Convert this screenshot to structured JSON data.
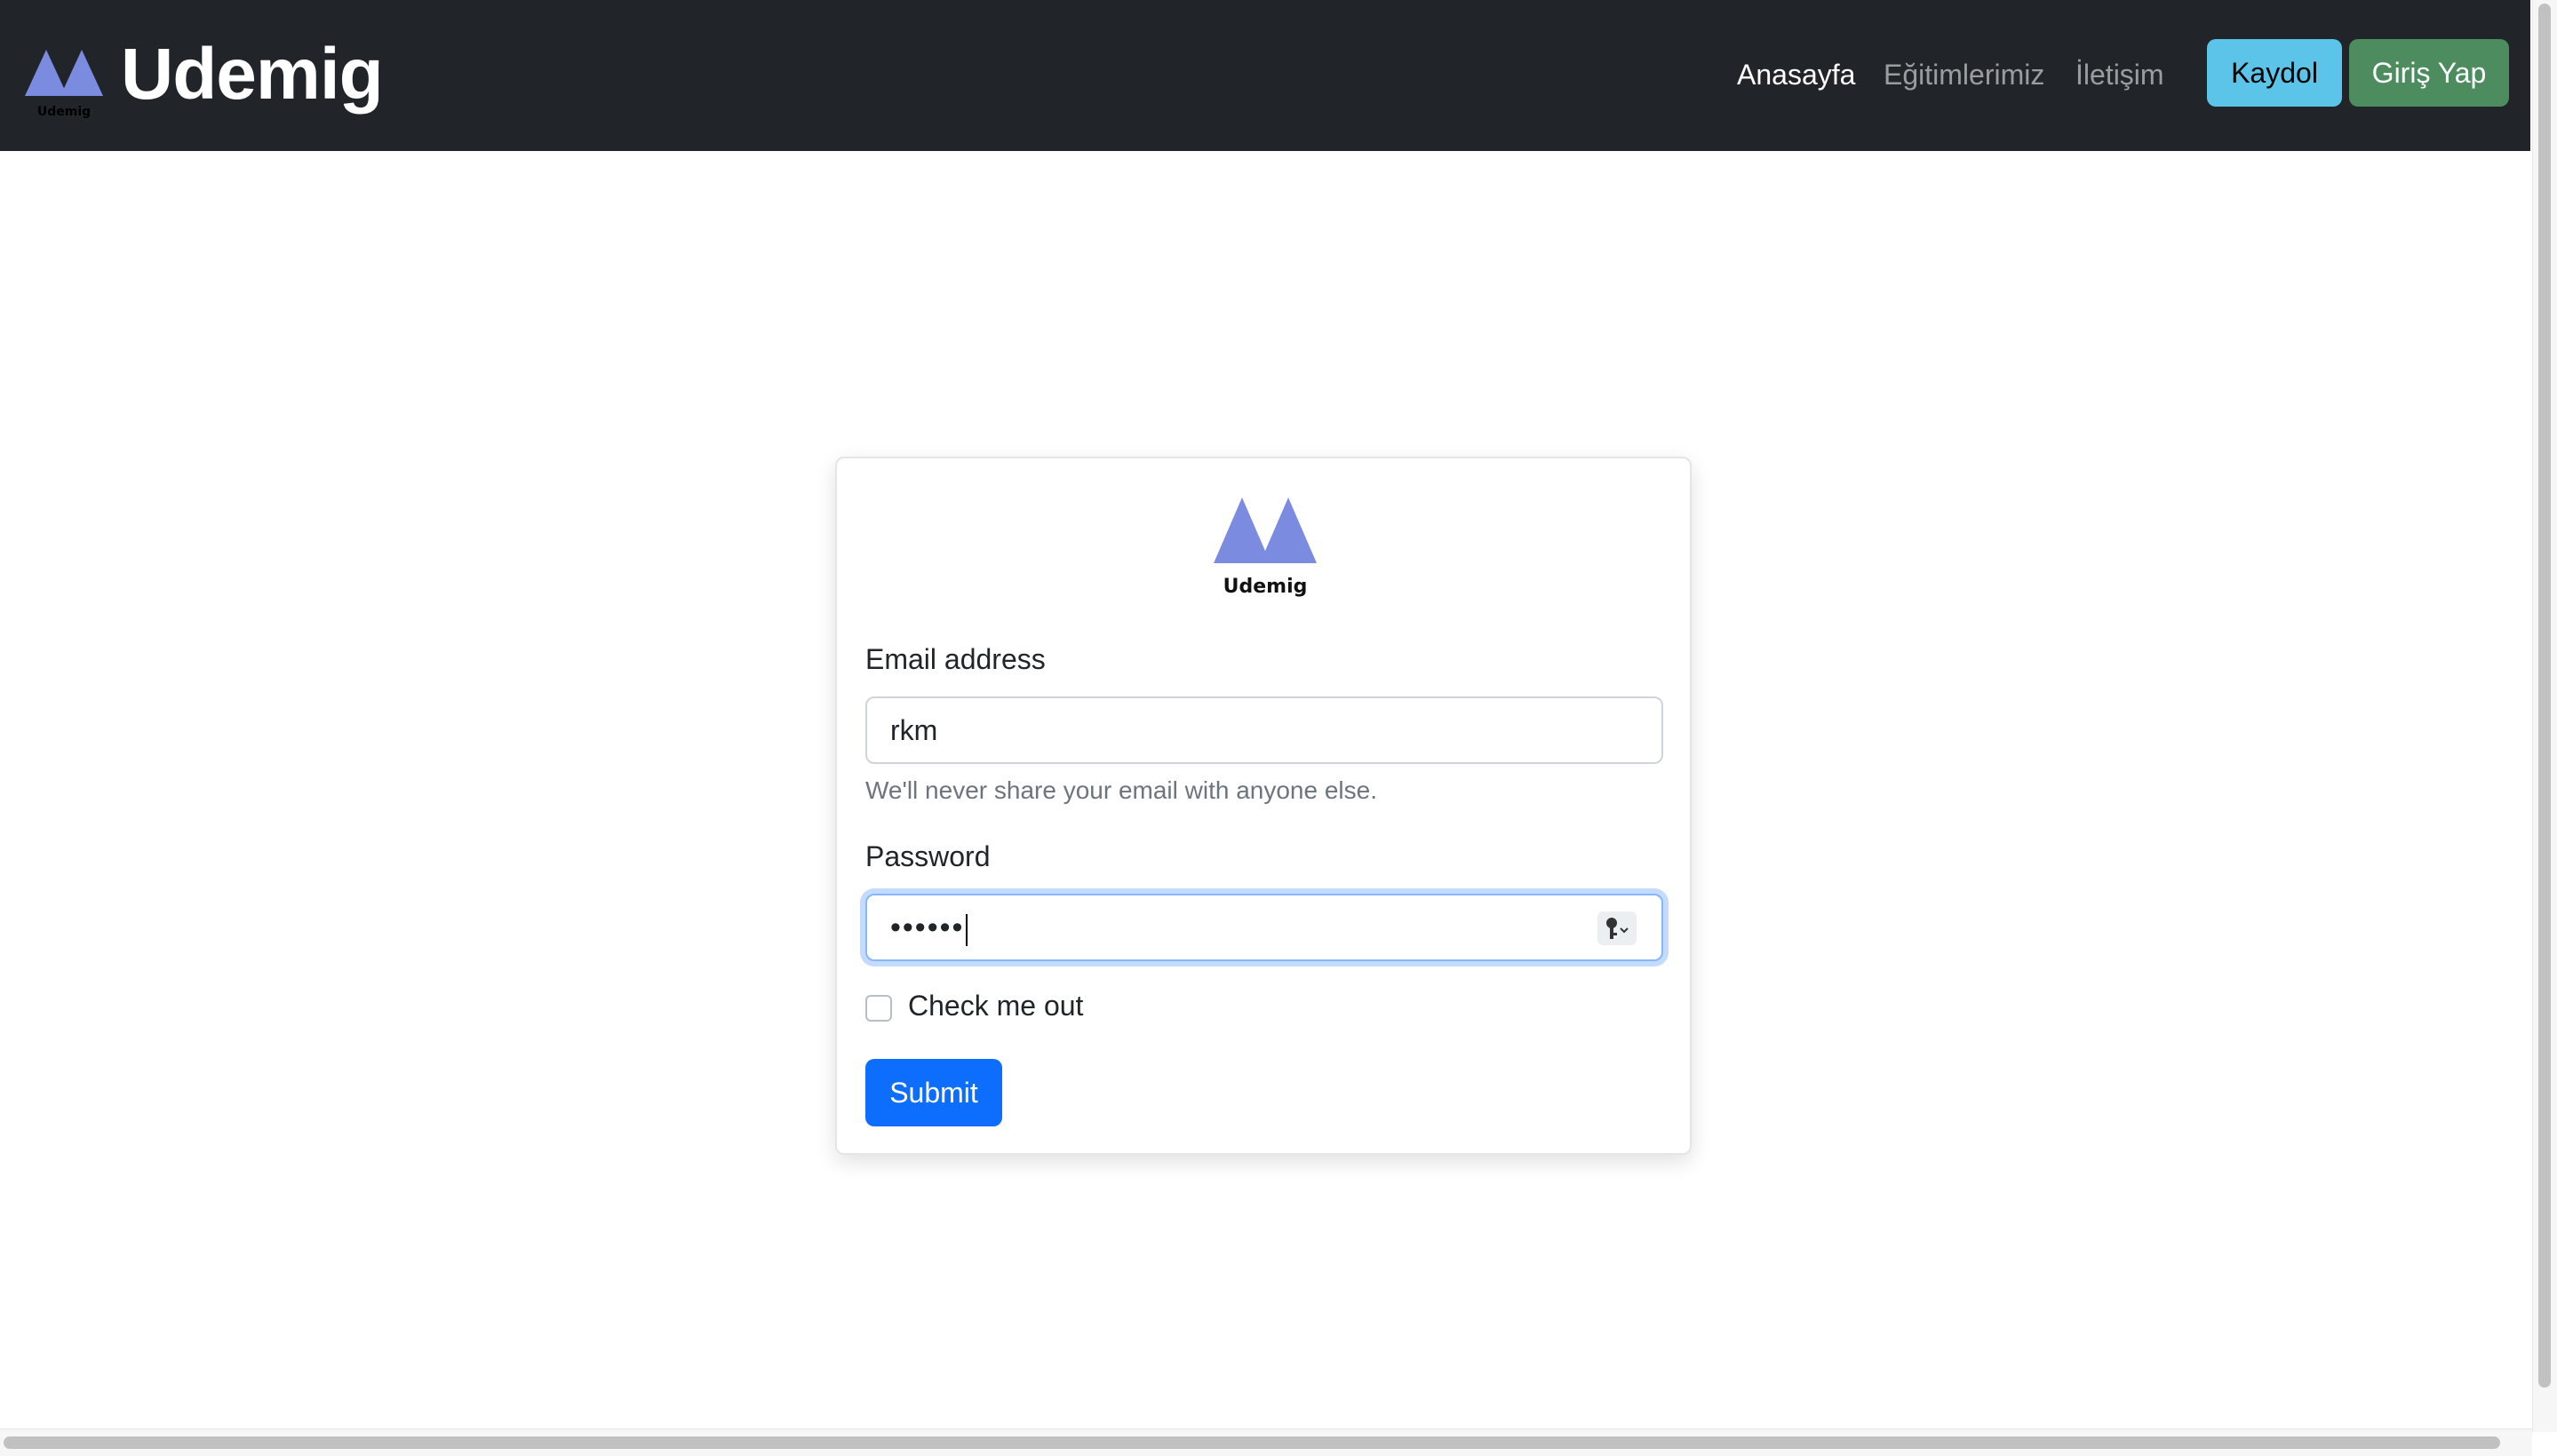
{
  "brand": {
    "name": "Udemig",
    "logo_caption": "Udemig",
    "logo_color": "#7b8be0"
  },
  "nav": {
    "links": [
      {
        "label": "Anasayfa",
        "active": true
      },
      {
        "label": "Eğitimlerimiz",
        "active": false
      },
      {
        "label": "İletişim",
        "active": false
      }
    ],
    "register_label": "Kaydol",
    "login_label": "Giriş Yap"
  },
  "form": {
    "logo_caption": "Udemig",
    "email_label": "Email address",
    "email_value": "rkm",
    "email_help": "We'll never share your email with anyone else.",
    "password_label": "Password",
    "password_value": "••••••",
    "checkbox_label": "Check me out",
    "checkbox_checked": false,
    "submit_label": "Submit"
  },
  "colors": {
    "navbar_bg": "#212529",
    "register_button": "#5dc4e9",
    "login_button": "#4d8c5f",
    "submit_button": "#0d6efd"
  }
}
